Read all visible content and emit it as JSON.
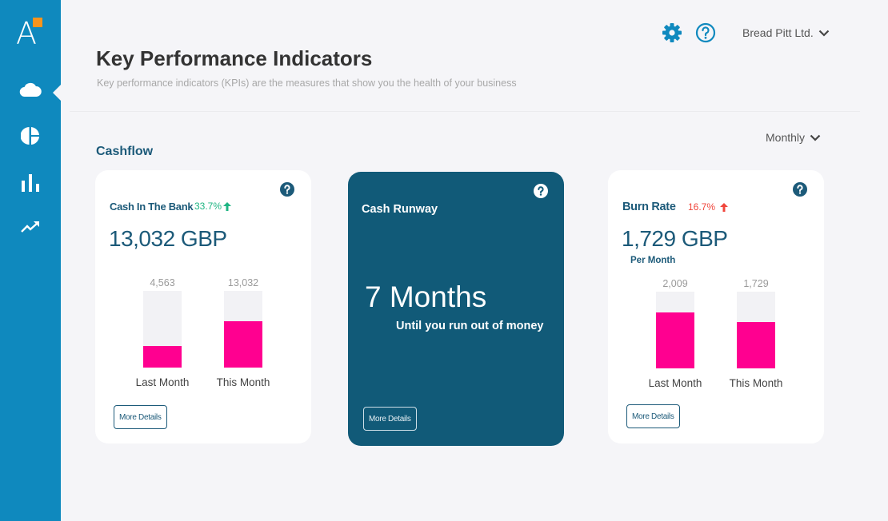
{
  "app": {
    "logo_letter": "A",
    "brand_color": "#0f89be",
    "accent_color": "#f7941d"
  },
  "sidebar": {
    "items": [
      {
        "icon": "cloud-icon",
        "label": "Cashflow",
        "active": true
      },
      {
        "icon": "pie-chart-icon",
        "label": "Pie chart"
      },
      {
        "icon": "bar-chart-icon",
        "label": "Bar chart"
      },
      {
        "icon": "trend-up-icon",
        "label": "Trends"
      }
    ]
  },
  "topbar": {
    "settings_icon": "gear-icon",
    "help_icon": "help-circle-icon",
    "company": "Bread Pitt Ltd."
  },
  "header": {
    "title": "Key Performance Indicators",
    "subtitle": "Key performance indicators (KPIs) are the measures that show you the health of your business"
  },
  "section": {
    "title": "Cashflow",
    "period": "Monthly"
  },
  "cards": {
    "cash_in_bank": {
      "label": "Cash In The Bank",
      "change": "33.7%",
      "change_direction": "up",
      "change_color": "#1fb583",
      "value": "13,032 GBP",
      "bars": [
        {
          "label": "Last Month",
          "value": "4,563",
          "fill": 0.28
        },
        {
          "label": "This Month",
          "value": "13,032",
          "fill": 0.6
        }
      ],
      "button": "More Details"
    },
    "cash_runway": {
      "label": "Cash Runway",
      "value": "7 Months",
      "subtext": "Until you run out of money",
      "button": "More Details"
    },
    "burn_rate": {
      "label": "Burn Rate",
      "change": "16.7%",
      "change_direction": "up",
      "change_color": "#f0463c",
      "value": "1,729 GBP",
      "per": "Per Month",
      "bars": [
        {
          "label": "Last Month",
          "value": "2,009",
          "fill": 0.73
        },
        {
          "label": "This Month",
          "value": "1,729",
          "fill": 0.6
        }
      ],
      "button": "More Details"
    }
  },
  "colors": {
    "bar_fill": "#ff0090",
    "bar_track": "#f2f2f5",
    "runway_bg": "#115a78",
    "text_primary": "#1c5a79"
  }
}
